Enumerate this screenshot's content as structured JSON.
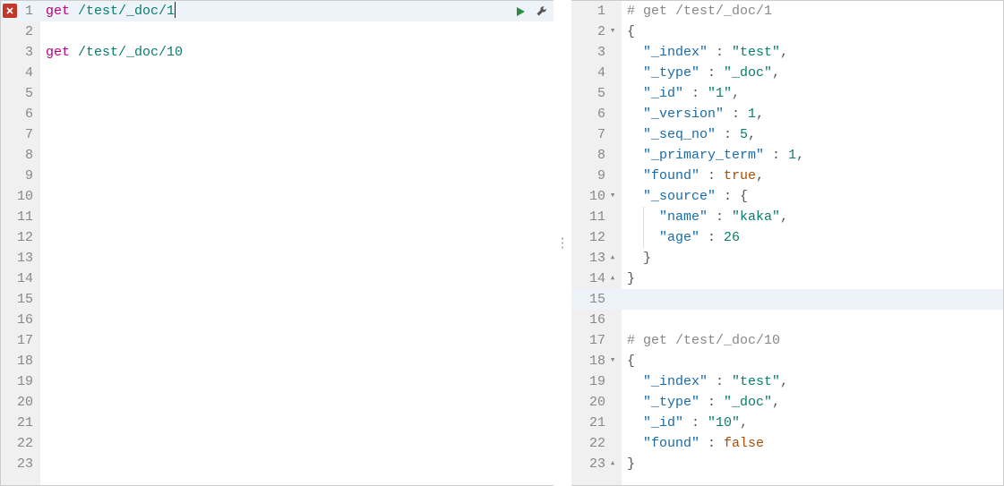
{
  "left": {
    "lines": [
      {
        "n": 1,
        "error": true,
        "highlight": true,
        "hasActions": true,
        "tokens": [
          {
            "cls": "kw",
            "t": "get"
          },
          {
            "cls": "",
            "t": " "
          },
          {
            "cls": "path",
            "t": "/test/_doc/1"
          }
        ],
        "cursorAfter": true
      },
      {
        "n": 2,
        "tokens": []
      },
      {
        "n": 3,
        "tokens": [
          {
            "cls": "kw",
            "t": "get"
          },
          {
            "cls": "",
            "t": " "
          },
          {
            "cls": "path",
            "t": "/test/_doc/10"
          }
        ]
      },
      {
        "n": 4,
        "tokens": []
      },
      {
        "n": 5,
        "tokens": []
      },
      {
        "n": 6,
        "tokens": []
      },
      {
        "n": 7,
        "tokens": []
      },
      {
        "n": 8,
        "tokens": []
      },
      {
        "n": 9,
        "tokens": []
      },
      {
        "n": 10,
        "tokens": []
      },
      {
        "n": 11,
        "tokens": []
      },
      {
        "n": 12,
        "tokens": []
      },
      {
        "n": 13,
        "tokens": []
      },
      {
        "n": 14,
        "tokens": []
      },
      {
        "n": 15,
        "tokens": []
      },
      {
        "n": 16,
        "tokens": []
      },
      {
        "n": 17,
        "tokens": []
      },
      {
        "n": 18,
        "tokens": []
      },
      {
        "n": 19,
        "tokens": []
      },
      {
        "n": 20,
        "tokens": []
      },
      {
        "n": 21,
        "tokens": []
      },
      {
        "n": 22,
        "tokens": []
      },
      {
        "n": 23,
        "tokens": []
      }
    ]
  },
  "right": {
    "lines": [
      {
        "n": 1,
        "fold": "",
        "tokens": [
          {
            "cls": "com",
            "t": "# get /test/_doc/1"
          }
        ]
      },
      {
        "n": 2,
        "fold": "open",
        "tokens": [
          {
            "cls": "pun",
            "t": "{"
          }
        ]
      },
      {
        "n": 3,
        "fold": "",
        "indent": 1,
        "tokens": [
          {
            "cls": "key",
            "t": "\"_index\""
          },
          {
            "cls": "pun",
            "t": " : "
          },
          {
            "cls": "str",
            "t": "\"test\""
          },
          {
            "cls": "pun",
            "t": ","
          }
        ]
      },
      {
        "n": 4,
        "fold": "",
        "indent": 1,
        "tokens": [
          {
            "cls": "key",
            "t": "\"_type\""
          },
          {
            "cls": "pun",
            "t": " : "
          },
          {
            "cls": "str",
            "t": "\"_doc\""
          },
          {
            "cls": "pun",
            "t": ","
          }
        ]
      },
      {
        "n": 5,
        "fold": "",
        "indent": 1,
        "tokens": [
          {
            "cls": "key",
            "t": "\"_id\""
          },
          {
            "cls": "pun",
            "t": " : "
          },
          {
            "cls": "str",
            "t": "\"1\""
          },
          {
            "cls": "pun",
            "t": ","
          }
        ]
      },
      {
        "n": 6,
        "fold": "",
        "indent": 1,
        "tokens": [
          {
            "cls": "key",
            "t": "\"_version\""
          },
          {
            "cls": "pun",
            "t": " : "
          },
          {
            "cls": "num",
            "t": "1"
          },
          {
            "cls": "pun",
            "t": ","
          }
        ]
      },
      {
        "n": 7,
        "fold": "",
        "indent": 1,
        "tokens": [
          {
            "cls": "key",
            "t": "\"_seq_no\""
          },
          {
            "cls": "pun",
            "t": " : "
          },
          {
            "cls": "num",
            "t": "5"
          },
          {
            "cls": "pun",
            "t": ","
          }
        ]
      },
      {
        "n": 8,
        "fold": "",
        "indent": 1,
        "tokens": [
          {
            "cls": "key",
            "t": "\"_primary_term\""
          },
          {
            "cls": "pun",
            "t": " : "
          },
          {
            "cls": "num",
            "t": "1"
          },
          {
            "cls": "pun",
            "t": ","
          }
        ]
      },
      {
        "n": 9,
        "fold": "",
        "indent": 1,
        "tokens": [
          {
            "cls": "key",
            "t": "\"found\""
          },
          {
            "cls": "pun",
            "t": " : "
          },
          {
            "cls": "bool",
            "t": "true"
          },
          {
            "cls": "pun",
            "t": ","
          }
        ]
      },
      {
        "n": 10,
        "fold": "open",
        "indent": 1,
        "tokens": [
          {
            "cls": "key",
            "t": "\"_source\""
          },
          {
            "cls": "pun",
            "t": " : {"
          }
        ]
      },
      {
        "n": 11,
        "fold": "",
        "indent": 2,
        "guide": true,
        "tokens": [
          {
            "cls": "key",
            "t": "\"name\""
          },
          {
            "cls": "pun",
            "t": " : "
          },
          {
            "cls": "str",
            "t": "\"kaka\""
          },
          {
            "cls": "pun",
            "t": ","
          }
        ]
      },
      {
        "n": 12,
        "fold": "",
        "indent": 2,
        "guide": true,
        "tokens": [
          {
            "cls": "key",
            "t": "\"age\""
          },
          {
            "cls": "pun",
            "t": " : "
          },
          {
            "cls": "num",
            "t": "26"
          }
        ]
      },
      {
        "n": 13,
        "fold": "close",
        "indent": 1,
        "tokens": [
          {
            "cls": "pun",
            "t": "}"
          }
        ]
      },
      {
        "n": 14,
        "fold": "close",
        "tokens": [
          {
            "cls": "pun",
            "t": "}"
          }
        ]
      },
      {
        "n": 15,
        "fold": "",
        "highlightR": true,
        "tokens": []
      },
      {
        "n": 16,
        "fold": "",
        "tokens": []
      },
      {
        "n": 17,
        "fold": "",
        "tokens": [
          {
            "cls": "com",
            "t": "# get /test/_doc/10"
          }
        ]
      },
      {
        "n": 18,
        "fold": "open",
        "tokens": [
          {
            "cls": "pun",
            "t": "{"
          }
        ]
      },
      {
        "n": 19,
        "fold": "",
        "indent": 1,
        "tokens": [
          {
            "cls": "key",
            "t": "\"_index\""
          },
          {
            "cls": "pun",
            "t": " : "
          },
          {
            "cls": "str",
            "t": "\"test\""
          },
          {
            "cls": "pun",
            "t": ","
          }
        ]
      },
      {
        "n": 20,
        "fold": "",
        "indent": 1,
        "tokens": [
          {
            "cls": "key",
            "t": "\"_type\""
          },
          {
            "cls": "pun",
            "t": " : "
          },
          {
            "cls": "str",
            "t": "\"_doc\""
          },
          {
            "cls": "pun",
            "t": ","
          }
        ]
      },
      {
        "n": 21,
        "fold": "",
        "indent": 1,
        "tokens": [
          {
            "cls": "key",
            "t": "\"_id\""
          },
          {
            "cls": "pun",
            "t": " : "
          },
          {
            "cls": "str",
            "t": "\"10\""
          },
          {
            "cls": "pun",
            "t": ","
          }
        ]
      },
      {
        "n": 22,
        "fold": "",
        "indent": 1,
        "tokens": [
          {
            "cls": "key",
            "t": "\"found\""
          },
          {
            "cls": "pun",
            "t": " : "
          },
          {
            "cls": "bool",
            "t": "false"
          }
        ]
      },
      {
        "n": 23,
        "fold": "close",
        "tokens": [
          {
            "cls": "pun",
            "t": "}"
          }
        ]
      }
    ]
  },
  "icons": {
    "run_title": "Run request",
    "wrench_title": "Options"
  }
}
